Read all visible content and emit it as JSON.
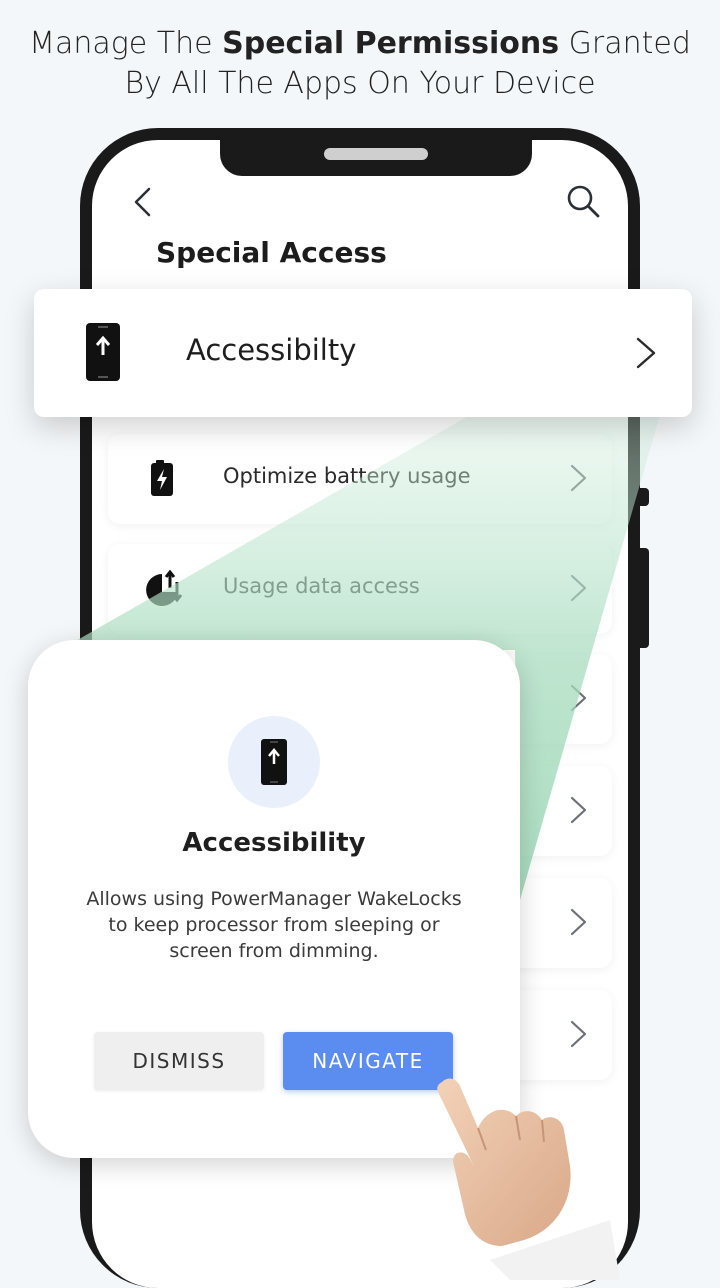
{
  "headline": {
    "line1_prefix": "Manage The ",
    "line1_bold": "Special Permissions",
    "line1_suffix": " Granted",
    "line2": "By All The Apps On Your Device"
  },
  "screen": {
    "title": "Special Access",
    "rows": [
      {
        "label": "Optimize battery usage",
        "icon": "battery-icon"
      },
      {
        "label": "Usage data access",
        "icon": "usage-data-icon"
      },
      {
        "label": "",
        "icon": ""
      },
      {
        "label": "",
        "icon": ""
      },
      {
        "label": "",
        "icon": ""
      },
      {
        "label": "",
        "icon": ""
      }
    ]
  },
  "highlight": {
    "label": "Accessibilty",
    "icon": "phone-upload-icon"
  },
  "dialog": {
    "title": "Accessibility",
    "body": "Allows using PowerManager WakeLocks to keep processor from sleeping or screen from dimming.",
    "dismiss_label": "DISMISS",
    "navigate_label": "NAVIGATE"
  },
  "colors": {
    "accent": "#5b8df0",
    "beam": "#a9dcbf",
    "icon_circle": "#e9f0fb"
  }
}
